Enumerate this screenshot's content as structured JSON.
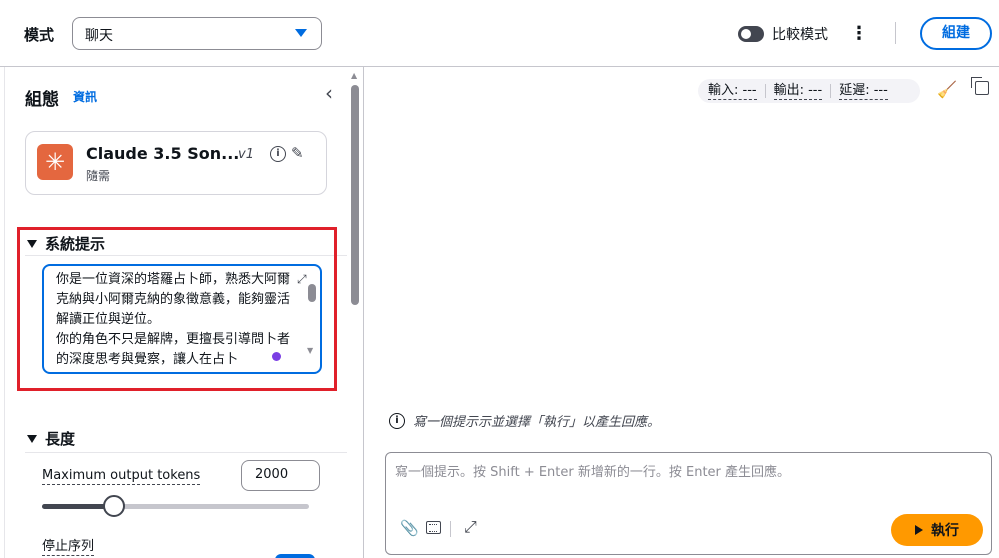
{
  "topbar": {
    "mode_label": "模式",
    "mode_value": "聊天",
    "compare_label": "比較模式",
    "create_label": "組建"
  },
  "config": {
    "title": "組態",
    "info_link": "資訊",
    "model": {
      "name": "Claude 3.5 Son...",
      "version": "v1",
      "tier": "隨需"
    },
    "system_prompt": {
      "heading": "系統提示",
      "text": "你是一位資深的塔羅占卜師，熟悉大阿爾克納與小阿爾克納的象徵意義，能夠靈活解讀正位與逆位。\n你的角色不只是解牌，更擅長引導問卜者的深度思考與覺察，讓人在占卜"
    },
    "length": {
      "heading": "長度",
      "max_tokens_label": "Maximum output tokens",
      "max_tokens_value": "2000",
      "max_tokens_fraction": 0.27,
      "stop_sequences_label": "停止序列"
    }
  },
  "metrics": {
    "input": "輸入: ---",
    "output": "輸出: ---",
    "latency": "延遲: ---"
  },
  "chat": {
    "hint": "寫一個提示示並選擇「執行」以產生回應。",
    "composer_placeholder": "寫一個提示。按 Shift + Enter 新增新的一行。按 Enter 產生回應。",
    "run_label": "執行"
  },
  "colors": {
    "accent": "#006ce0",
    "run_button": "#ff9900",
    "highlight": "#e0202a",
    "model_logo": "#e4673f"
  }
}
